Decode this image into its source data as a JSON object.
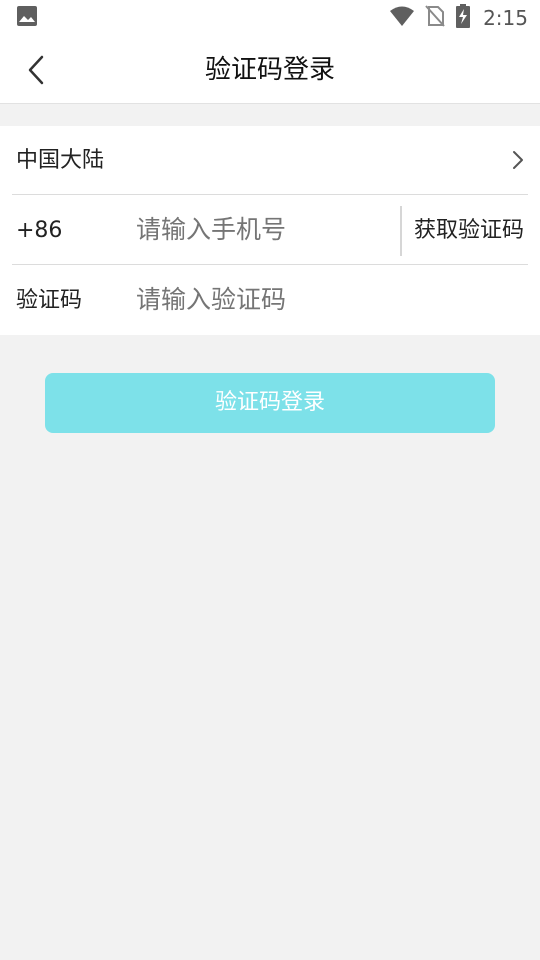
{
  "status_bar": {
    "time": "2:15",
    "icons": [
      "image-icon",
      "wifi-icon",
      "no-sim-icon",
      "battery-charging-icon"
    ]
  },
  "header": {
    "title": "验证码登录",
    "back_icon": "chevron-left-icon"
  },
  "form": {
    "region": {
      "label": "中国大陆",
      "icon": "chevron-right-icon"
    },
    "phone": {
      "prefix": "+86",
      "placeholder": "请输入手机号",
      "value": "",
      "get_code_label": "获取验证码"
    },
    "code": {
      "label": "验证码",
      "placeholder": "请输入验证码",
      "value": ""
    }
  },
  "login_button": {
    "label": "验证码登录"
  },
  "colors": {
    "accent": "#7de1e9",
    "background": "#f2f2f2",
    "placeholder": "#a6a6a6"
  }
}
